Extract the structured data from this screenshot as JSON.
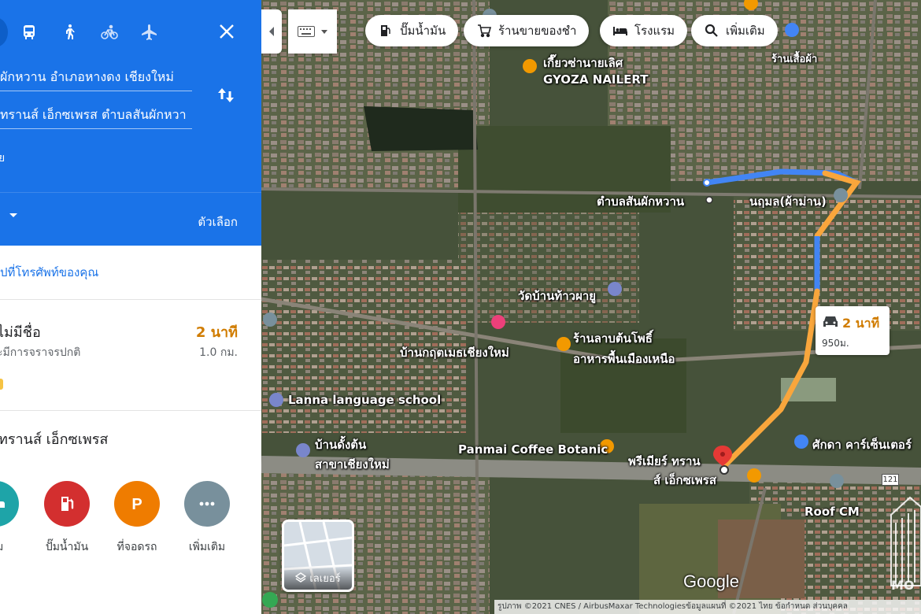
{
  "panel": {
    "origin": "ผักหวาน อำเภอหางดง เชียงใหม่",
    "destination": "ทรานส์ เอ็กซเพรส ตำบลสันผักหวา",
    "via": "ย",
    "options_label": "ตัวเลือก",
    "send_to_phone": "ปที่โทรศัพท์ของคุณ",
    "route": {
      "name": "ี่ไม่มีชื่อ",
      "time": "2 นาที",
      "traffic": "ะมีการจราจรปกติ",
      "distance": "1.0 กม."
    },
    "destination_title": "ทรานส์ เอ็กซเพรส",
    "nearby": [
      {
        "label": "รม",
        "icon": "hotel-icon",
        "color": "#1ea4a8"
      },
      {
        "label": "ปั๊มน้ำมัน",
        "icon": "gas-station-icon",
        "color": "#d32f2f"
      },
      {
        "label": "ที่จอดรถ",
        "icon": "parking-icon",
        "color": "#ef7c00"
      },
      {
        "label": "เพิ่มเติม",
        "icon": "more-icon",
        "color": "#78909c"
      }
    ]
  },
  "map": {
    "chips": [
      {
        "label": "ปั๊มน้ำมัน",
        "icon": "gas-station-icon"
      },
      {
        "label": "ร้านขายของชำ",
        "icon": "cart-icon"
      },
      {
        "label": "โรงแรม",
        "icon": "bed-icon"
      },
      {
        "label": "เพิ่มเติม",
        "icon": "search-icon"
      }
    ],
    "callout": {
      "time": "2 นาที",
      "distance": "950ม."
    },
    "labels": {
      "gyoza": "เกี๊ยวซ่านายเลิศ",
      "gyoza_en": "GYOZA NAILERT",
      "sanphak": "ตำบลสันผักหวาน",
      "natthamon": "นฤมล(ผ้าม่าน)",
      "wat": "วัดบ้านท้าวผายู",
      "lap": "ร้านลาบต้นโพธิ์",
      "lap2": "อาหารพื้นเมืองเหนือ",
      "ban": "บ้านกฤตเมธเชียงใหม่",
      "lanna": "Lanna language school",
      "bandung": "บ้านดั้งต้น",
      "bandung2": "สาขาเชียงใหม่",
      "panmai": "Panmai Coffee Botanic",
      "premier": "พรีเมียร์ ทราน",
      "premier2": "ส์ เอ็กซเพรส",
      "sakda": "ศักดา คาร์เซ็นเตอร์",
      "roof": "Roof CM",
      "shop_top": "ร้านเสื้อผ้า",
      "road_num": "121"
    },
    "layers_label": "เลเยอร์",
    "google": "Google",
    "attribution": "รูปภาพ ©2021 CNES / AirbusMaxar Technologiesข้อมูลแผนที่ ©2021   ไทย   ข้อกำหนด   ส่วนบุคคล",
    "watermark": "MO"
  }
}
